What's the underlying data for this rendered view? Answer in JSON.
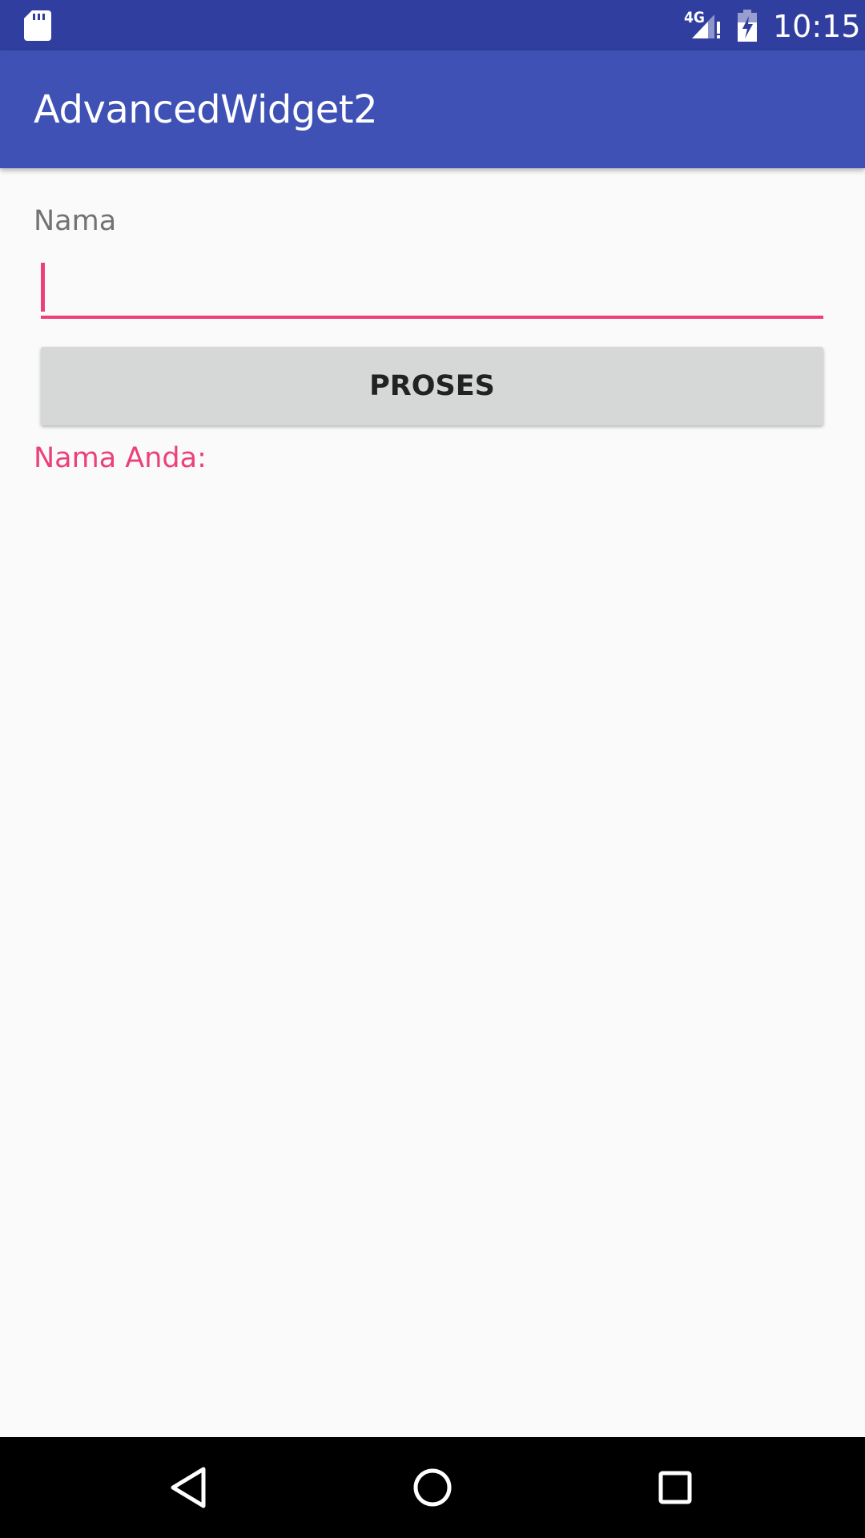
{
  "status_bar": {
    "network_type": "4G",
    "time": "10:15",
    "icons": [
      "sd-card-icon",
      "signal-icon",
      "battery-charging-icon"
    ]
  },
  "app_bar": {
    "title": "AdvancedWidget2"
  },
  "form": {
    "field_label": "Nama",
    "input_value": "",
    "button_label": "PROSES",
    "result_label": "Nama Anda:"
  },
  "nav_bar": {
    "icons": [
      "back-icon",
      "home-icon",
      "recents-icon"
    ]
  },
  "colors": {
    "status_bar": "#303f9f",
    "app_bar": "#3f51b5",
    "accent": "#ec407a",
    "button": "#d6d7d7",
    "background": "#fafafa"
  }
}
